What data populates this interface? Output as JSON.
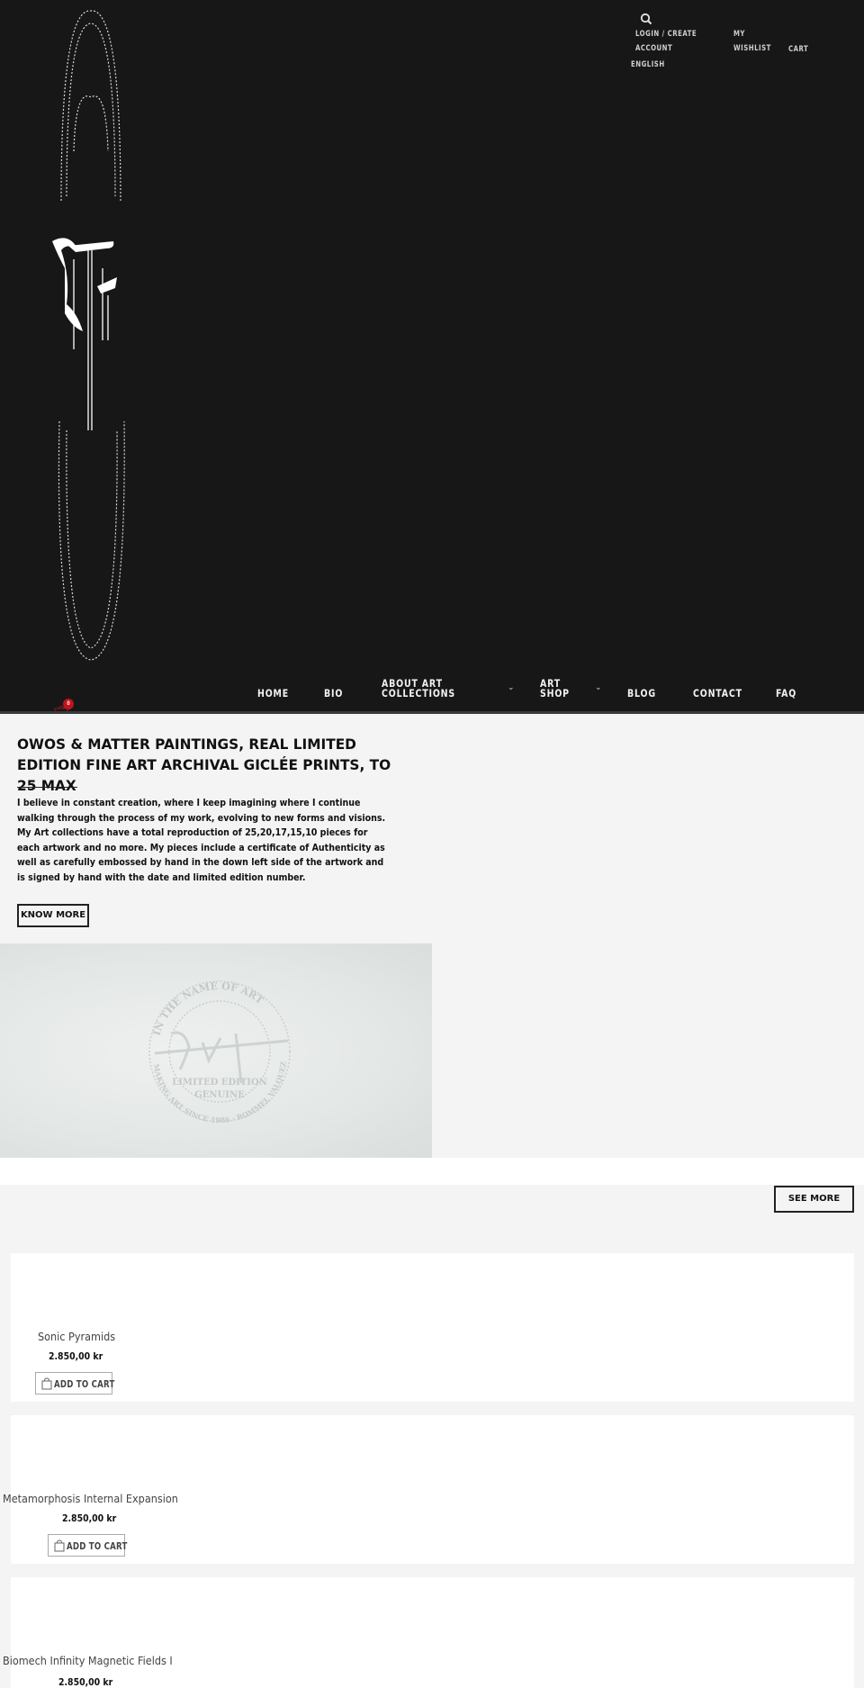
{
  "header": {
    "top_links": {
      "login": "LOGIN / CREATE ACCOUNT",
      "wishlist": "MY WISHLIST",
      "cart": "CART",
      "language": "ENGLISH"
    },
    "icons": {
      "search": "search-icon",
      "mini_cart": "shopping-bag-icon"
    },
    "cart_count": "0",
    "logo_alt": "R.Valquez logo"
  },
  "nav": {
    "items": [
      {
        "label": "HOME"
      },
      {
        "label": "BIO"
      },
      {
        "label": "ABOUT ART COLLECTIONS",
        "has_submenu": true
      },
      {
        "label": "ART SHOP",
        "has_submenu": true
      },
      {
        "label": "BLOG"
      },
      {
        "label": "CONTACT"
      },
      {
        "label": "FAQ"
      }
    ],
    "chevron": "⌄"
  },
  "intro": {
    "title": "OWOS & MATTER PAINTINGS, REAL LIMITED EDITION FINE ART ARCHIVAL GICLÉE PRINTS, TO 25 MAX",
    "text": "I believe in constant creation, where I keep imagining where I continue walking through the process of my work, evolving to new forms and visions. My Art collections have a total reproduction of 25,20,17,15,10 pieces for each artwork and no more. My pieces include a certificate of Authenticity as well as carefully embossed by hand in the down left side of the artwork and is signed by hand with the date and limited edition number.",
    "button": "KNOW MORE"
  },
  "emboss": {
    "top_text": "IN THE NAME OF ART",
    "middle_text_1": "LIMITED EDITION",
    "middle_text_2": "GENUINE",
    "bottom_text": "MAKING ART SINCE 1986 · ROMMEL VALQUEZ"
  },
  "see_more": "SEE MORE",
  "products": [
    {
      "name": "Sonic Pyramids",
      "price": "2.850,00 kr",
      "button": "ADD TO CART"
    },
    {
      "name": "Metamorphosis Internal Expansion",
      "price": "2.850,00 kr",
      "button": "ADD TO CART"
    },
    {
      "name": "Biomech Infinity Magnetic Fields I",
      "price": "2.850,00 kr"
    }
  ]
}
